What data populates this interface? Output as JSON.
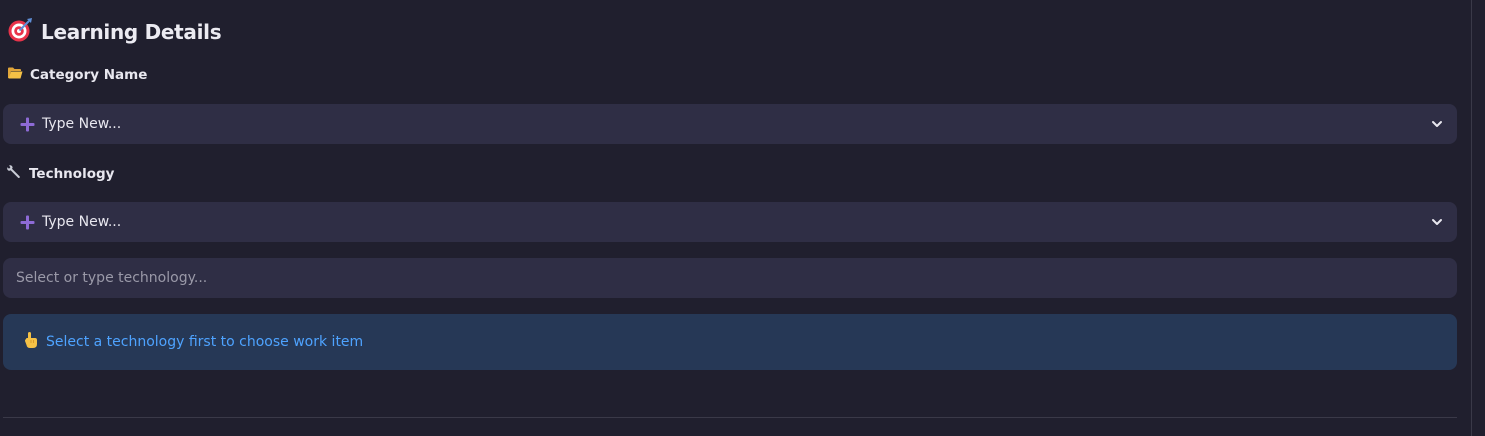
{
  "section": {
    "title": "Learning Details",
    "title_icon": "target-dart-icon"
  },
  "category": {
    "label": "Category Name",
    "label_icon": "folder-icon",
    "select_value": "Type New...",
    "select_icon": "plus-icon"
  },
  "technology": {
    "label": "Technology",
    "label_icon": "wrench-icon",
    "select_value": "Type New...",
    "select_icon": "plus-icon",
    "input_placeholder": "Select or type technology..."
  },
  "info": {
    "icon": "pointing-hand-icon",
    "message": "Select a technology first to choose work item"
  },
  "colors": {
    "background": "#201f2e",
    "field": "#2f2e45",
    "info_bg": "#263856",
    "info_text": "#4ea3ff",
    "plus_accent": "#8e6bd6"
  }
}
